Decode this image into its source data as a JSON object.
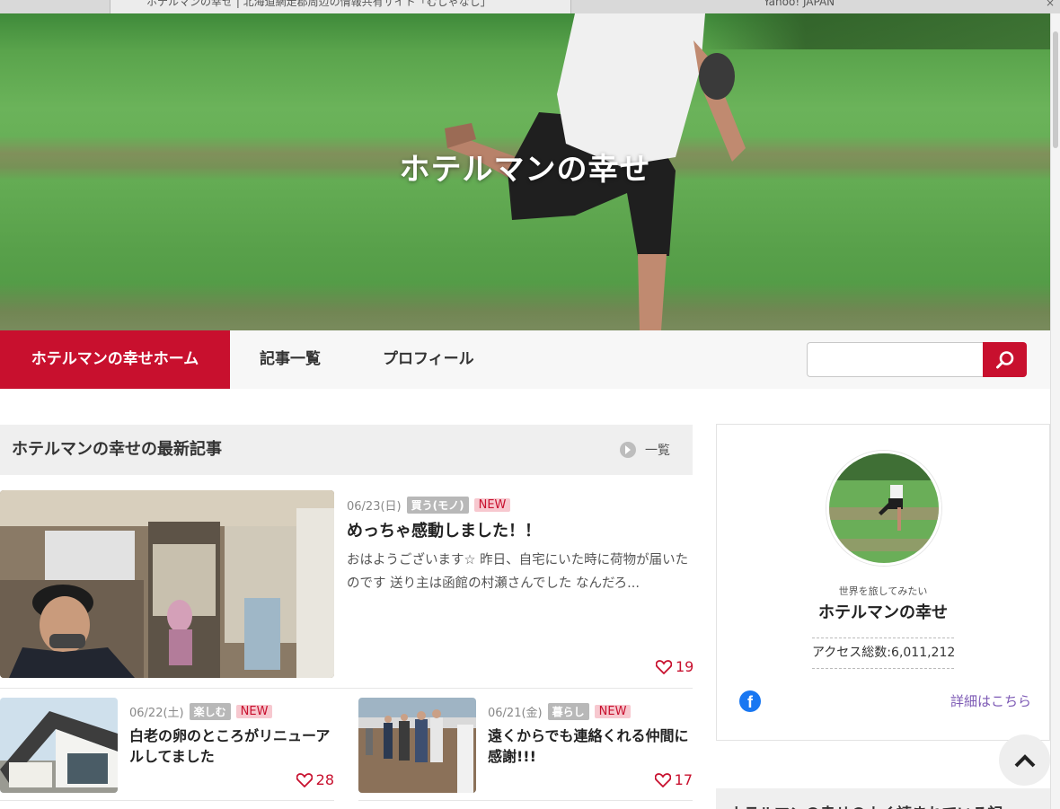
{
  "browser": {
    "tabs": [
      {
        "label": "ホテルマンの幸せ | 北海道網走郡周辺の情報共有サイト「むしゃなし」"
      },
      {
        "label": "Yahoo! JAPAN"
      }
    ]
  },
  "header": {
    "title": "ホテルマンの幸せ"
  },
  "nav": {
    "items": [
      {
        "label": "ホテルマンの幸せホーム",
        "active": true
      },
      {
        "label": "記事一覧"
      },
      {
        "label": "プロフィール"
      }
    ],
    "search": {
      "value": "",
      "placeholder": ""
    }
  },
  "latest": {
    "heading": "ホテルマンの幸せの最新記事",
    "more_label": "一覧",
    "featured": {
      "date": "06/23(日)",
      "category": "買う(モノ)",
      "badge": "NEW",
      "title": "めっちゃ感動しました！！",
      "excerpt": "おはようございます☆ 昨日、自宅にいた時に荷物が届いたのです 送り主は函館の村瀬さんでした なんだろ...",
      "likes": "19"
    },
    "articles": [
      {
        "date": "06/22(土)",
        "category": "楽しむ",
        "badge": "NEW",
        "title": "白老の卵のところがリニューアルしてました",
        "likes": "28"
      },
      {
        "date": "06/21(金)",
        "category": "暮らし",
        "badge": "NEW",
        "title": "遠くからでも連絡くれる仲間に感謝!!!",
        "likes": "17"
      }
    ]
  },
  "profile": {
    "catchphrase": "世界を旅してみたい",
    "name": "ホテルマンの幸せ",
    "access_label": "アクセス総数:",
    "access_count": "6,011,212",
    "detail_link": "詳細はこちら"
  },
  "sidebar_next": {
    "heading": "ホテルマンの幸せのよく読まれている記"
  },
  "colors": {
    "accent": "#c8102e",
    "link": "#7d5ab5",
    "facebook": "#1877f2"
  },
  "icons": {
    "search": "search-icon",
    "more": "circle-arrow-icon",
    "heart": "heart-icon",
    "facebook": "facebook-icon",
    "to_top": "chevron-up-icon"
  }
}
